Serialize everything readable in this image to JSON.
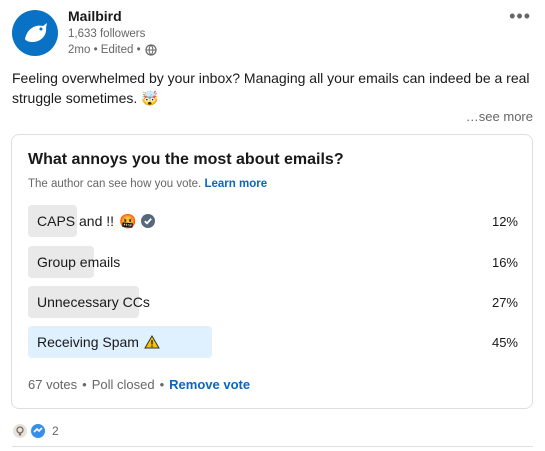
{
  "author": {
    "name": "Mailbird",
    "followers": "1,633 followers",
    "meta": "2mo • Edited •"
  },
  "post": {
    "text": "Feeling overwhelmed by your inbox? Managing all your emails can indeed be a real struggle sometimes.",
    "see_more": "…see more"
  },
  "poll": {
    "question": "What annoys you the most about emails?",
    "note": "The author can see how you vote.",
    "learn_more": "Learn more",
    "options": [
      {
        "label": "CAPS and !!",
        "percent": "12%",
        "value": 12,
        "selected": false
      },
      {
        "label": "Group emails",
        "percent": "16%",
        "value": 16,
        "selected": false
      },
      {
        "label": "Unnecessary CCs",
        "percent": "27%",
        "value": 27,
        "selected": false
      },
      {
        "label": "Receiving Spam",
        "percent": "45%",
        "value": 45,
        "selected": true
      }
    ],
    "votes": "67 votes",
    "status": "Poll closed",
    "remove_vote": "Remove vote"
  },
  "reactions": {
    "count": "2"
  },
  "colors": {
    "brand": "#0a72c4",
    "link": "#0a66c2",
    "selected_fill": "#dff0fe",
    "option_fill": "#e9e9e9"
  }
}
